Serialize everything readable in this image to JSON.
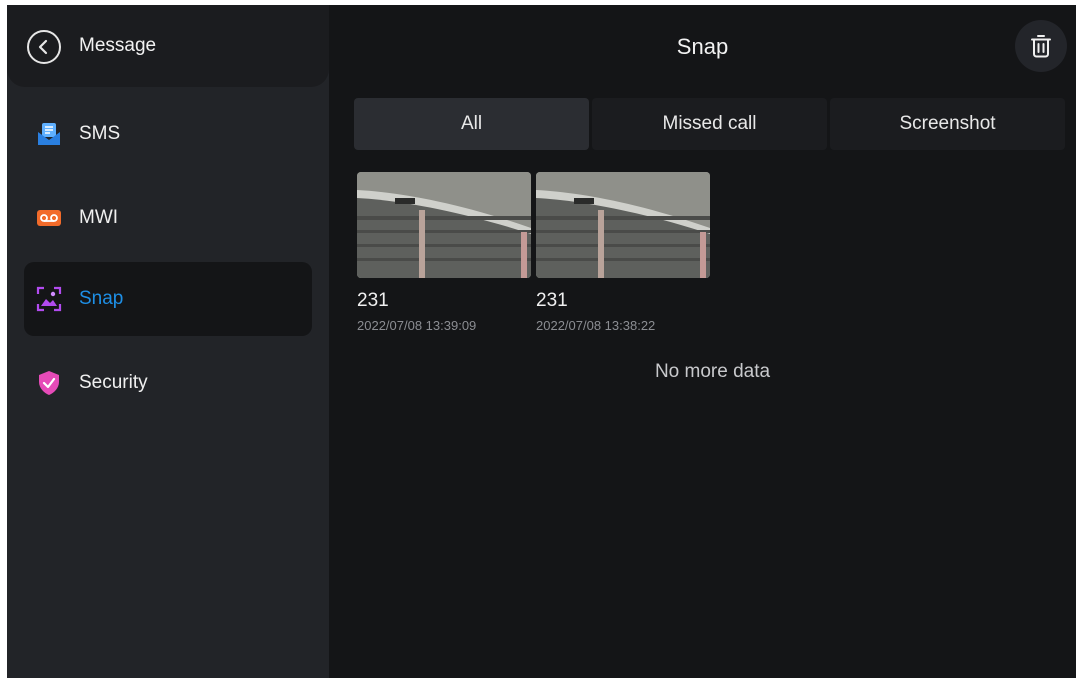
{
  "sidebar": {
    "title": "Message",
    "items": [
      {
        "label": "SMS",
        "icon": "sms-icon",
        "color": "#2f8ff0"
      },
      {
        "label": "MWI",
        "icon": "voicemail-icon",
        "color": "#f26b2a"
      },
      {
        "label": "Snap",
        "icon": "snap-icon",
        "color": "#b24bf0",
        "active": true
      },
      {
        "label": "Security",
        "icon": "shield-icon",
        "color": "#e64bb8"
      }
    ]
  },
  "header": {
    "title": "Snap"
  },
  "tabs": [
    {
      "label": "All",
      "active": true
    },
    {
      "label": "Missed call"
    },
    {
      "label": "Screenshot"
    }
  ],
  "snaps": [
    {
      "title": "231",
      "time": "2022/07/08 13:39:09"
    },
    {
      "title": "231",
      "time": "2022/07/08 13:38:22"
    }
  ],
  "footer_text": "No more data",
  "colors": {
    "accent": "#1e8fe6",
    "background": "#141517",
    "sidebar": "#222428"
  }
}
